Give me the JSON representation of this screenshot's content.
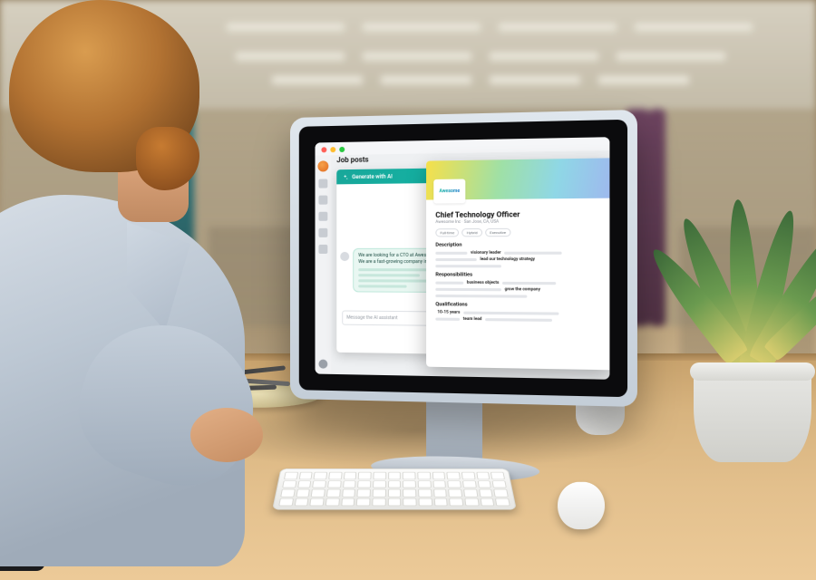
{
  "app": {
    "page_title": "Job posts",
    "sidebar_icons": [
      "dashboard",
      "jobs",
      "mail",
      "tasks",
      "analytics"
    ]
  },
  "generate_panel": {
    "header_label": "Generate with AI",
    "chat_message": "We are looking for a CTO at Awesome Inc. We are a fast-growing company in",
    "input_placeholder": "Message the AI assistant"
  },
  "job_post": {
    "company_logo_text": "Awesome",
    "title": "Chief Technology Officer",
    "meta": "Awesome Inc · San Jose, CA, USA",
    "tags": [
      "Full-time",
      "Hybrid",
      "Executive"
    ],
    "sections": {
      "description": {
        "heading": "Description",
        "keywords": [
          "visionary leader",
          "lead our technology strategy"
        ]
      },
      "responsibilities": {
        "heading": "Responsibilities",
        "keywords": [
          "business objects",
          "grow the company"
        ]
      },
      "qualifications": {
        "heading": "Qualifications",
        "keywords": [
          "10-15 years",
          "team lead"
        ]
      }
    }
  }
}
